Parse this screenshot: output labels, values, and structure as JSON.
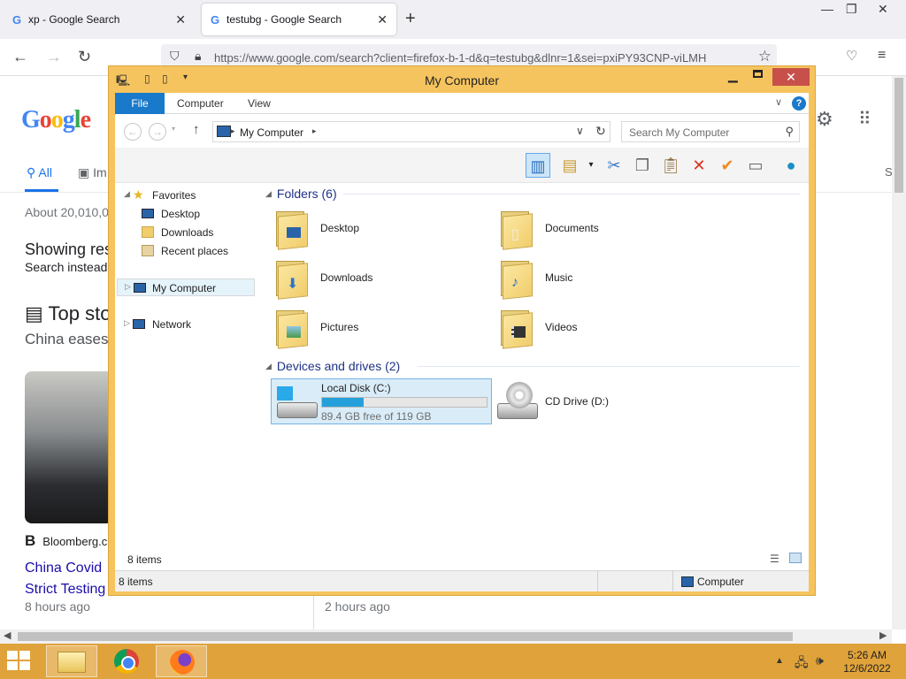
{
  "browser": {
    "tabs": [
      {
        "label": "xp - Google Search",
        "active": false
      },
      {
        "label": "testubg - Google Search",
        "active": true
      }
    ],
    "url": "https://www.google.com/search?client=firefox-b-1-d&q=testubg&dlnr=1&sei=pxiPY93CNP-viLMH"
  },
  "google": {
    "logo_text": "Google",
    "tab_all": "All",
    "tab_images": "Im",
    "about": "About 20,010,0",
    "showing": "Showing res",
    "search_instead": "Search instead",
    "top_stories": "Top sto",
    "china_eases": "China eases",
    "source": "Bloomberg.c",
    "headline_1": "China Covid",
    "headline_2": "Strict Testing",
    "time_1": "8 hours ago",
    "time_2": "2 hours ago",
    "right_tab_initial": "S"
  },
  "explorer": {
    "title": "My Computer",
    "ribbon_tabs": [
      "File",
      "Computer",
      "View"
    ],
    "breadcrumb": "My Computer",
    "search_placeholder": "Search My Computer",
    "nav": {
      "favorites": "Favorites",
      "favorites_items": [
        "Desktop",
        "Downloads",
        "Recent places"
      ],
      "my_computer": "My Computer",
      "network": "Network"
    },
    "folders_header": "Folders (6)",
    "folders": [
      {
        "name": "Desktop",
        "icon": "desktop-folder"
      },
      {
        "name": "Documents",
        "icon": "documents-folder"
      },
      {
        "name": "Downloads",
        "icon": "downloads-folder"
      },
      {
        "name": "Music",
        "icon": "music-folder"
      },
      {
        "name": "Pictures",
        "icon": "pictures-folder"
      },
      {
        "name": "Videos",
        "icon": "videos-folder"
      }
    ],
    "devices_header": "Devices and drives (2)",
    "drive_c": {
      "name": "Local Disk (C:)",
      "free": "89.4 GB free of 119 GB",
      "used_fraction": 0.25
    },
    "drive_d": {
      "name": "CD Drive (D:)"
    },
    "item_count": "8 items",
    "status_items": "8 items",
    "status_location": "Computer"
  },
  "taskbar": {
    "time": "5:26 AM",
    "date": "12/6/2022"
  },
  "colors": {
    "window_frame": "#f6c45e",
    "taskbar": "#e0a23a",
    "file_tab": "#1979ca",
    "progress": "#26a0da"
  }
}
